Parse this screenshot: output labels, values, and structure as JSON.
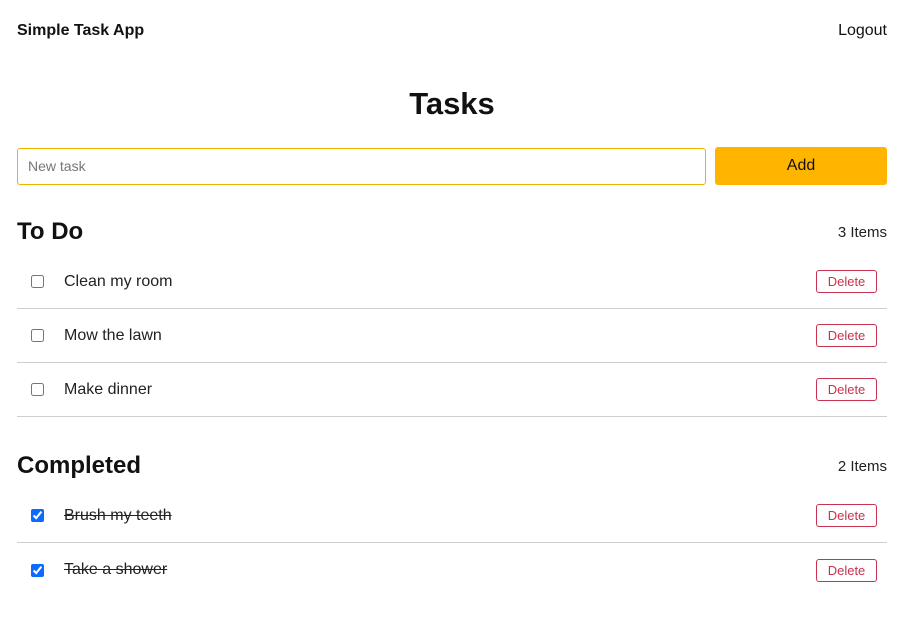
{
  "header": {
    "brand": "Simple Task App",
    "logout_label": "Logout"
  },
  "main": {
    "title": "Tasks",
    "new_task": {
      "placeholder": "New task",
      "value": ""
    },
    "add_label": "Add"
  },
  "todo": {
    "title": "To Do",
    "count": "3 Items",
    "items": [
      {
        "label": "Clean my room",
        "checked": false,
        "delete_label": "Delete"
      },
      {
        "label": "Mow the lawn",
        "checked": false,
        "delete_label": "Delete"
      },
      {
        "label": "Make dinner",
        "checked": false,
        "delete_label": "Delete"
      }
    ]
  },
  "completed": {
    "title": "Completed",
    "count": "2 Items",
    "items": [
      {
        "label": "Brush my teeth",
        "checked": true,
        "delete_label": "Delete"
      },
      {
        "label": "Take a shower",
        "checked": true,
        "delete_label": "Delete"
      }
    ]
  },
  "colors": {
    "accent": "#ffb400",
    "danger": "#c8324e",
    "checkbox": "#0a6cff"
  }
}
